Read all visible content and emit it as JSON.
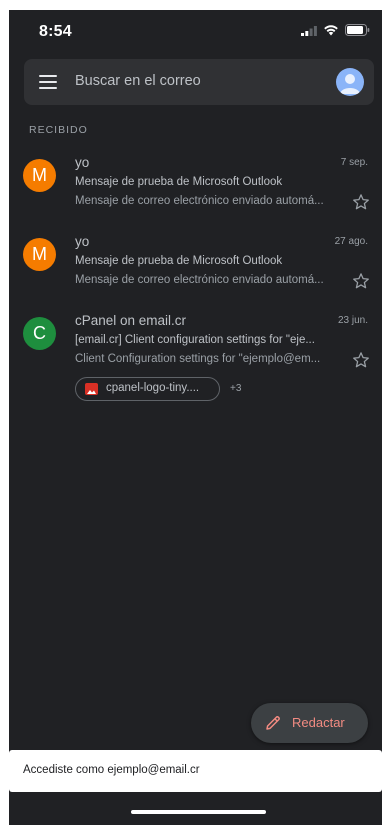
{
  "status_bar": {
    "time": "8:54"
  },
  "search": {
    "placeholder": "Buscar en el correo",
    "menu_icon": "hamburger-menu-icon",
    "avatar_icon": "account-avatar-icon"
  },
  "inbox": {
    "section_label": "RECIBIDO",
    "emails": [
      {
        "avatar_letter": "M",
        "avatar_color": "#f57c00",
        "sender": "yo",
        "date": "7 sep.",
        "subject": "Mensaje de prueba de Microsoft Outlook",
        "snippet": "Mensaje de correo electrónico enviado automá...",
        "starred": false
      },
      {
        "avatar_letter": "M",
        "avatar_color": "#f57c00",
        "sender": "yo",
        "date": "27 ago.",
        "subject": "Mensaje de prueba de Microsoft Outlook",
        "snippet": "Mensaje de correo electrónico enviado automá...",
        "starred": false
      },
      {
        "avatar_letter": "C",
        "avatar_color": "#1e8e3e",
        "sender": "cPanel on email.cr",
        "date": "23 jun.",
        "subject": "[email.cr] Client configuration settings for \"eje...",
        "snippet": "Client Configuration settings for \"ejemplo@em...",
        "starred": false,
        "attachment": {
          "label": "cpanel-logo-tiny....",
          "icon": "image-icon",
          "more_count": "+3"
        }
      }
    ]
  },
  "compose": {
    "label": "Redactar",
    "icon": "pencil-icon",
    "accent_color": "#f28b82"
  },
  "snackbar": {
    "text": "Accediste como ejemplo@email.cr"
  },
  "colors": {
    "background": "#202124",
    "search_bar": "#303134",
    "text_primary": "#bdc1c6",
    "text_secondary": "#9aa0a6"
  }
}
